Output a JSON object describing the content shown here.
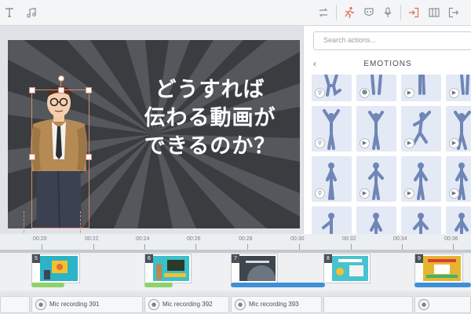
{
  "toolbar": {
    "left_icons": [
      "text-icon",
      "music-note-icon"
    ],
    "right_icons": [
      "swap-icon",
      "character-action-icon",
      "mask-icon",
      "microphone-icon",
      "enter-icon",
      "layers-icon",
      "exit-icon"
    ],
    "active_icon": "character-action-icon",
    "accent": "#e06b4f"
  },
  "slide": {
    "lines": [
      "どうすれば",
      "伝わる動画が",
      "できるのか？"
    ],
    "background": "#3a3d40",
    "ray_color": "#54585c",
    "text_color": "#ffffff"
  },
  "panel": {
    "search_placeholder": "Search actions...",
    "title": "EMOTIONS",
    "back_icon": "chevron-left-icon",
    "tile_color": "#e3e9f5",
    "figure_color": "#6f86b6"
  },
  "timeline": {
    "ticks": [
      "00:20",
      "00:22",
      "00:24",
      "00:26",
      "00:28",
      "00:30",
      "00:32",
      "00:34",
      "00:36"
    ],
    "scenes": [
      {
        "number": "5",
        "thumb_color": "#2bb3c6"
      },
      {
        "number": "6",
        "thumb_color": "#3cc0c9"
      },
      {
        "number": "7",
        "thumb_color": "#40464d"
      },
      {
        "number": "8",
        "thumb_color": "#49c2cf"
      },
      {
        "number": "9",
        "thumb_color": "#e6b52f"
      }
    ],
    "mic_recordings": [
      "",
      "Mic recording 391",
      "Mic recording 392",
      "Mic recording 393",
      "",
      ""
    ]
  }
}
